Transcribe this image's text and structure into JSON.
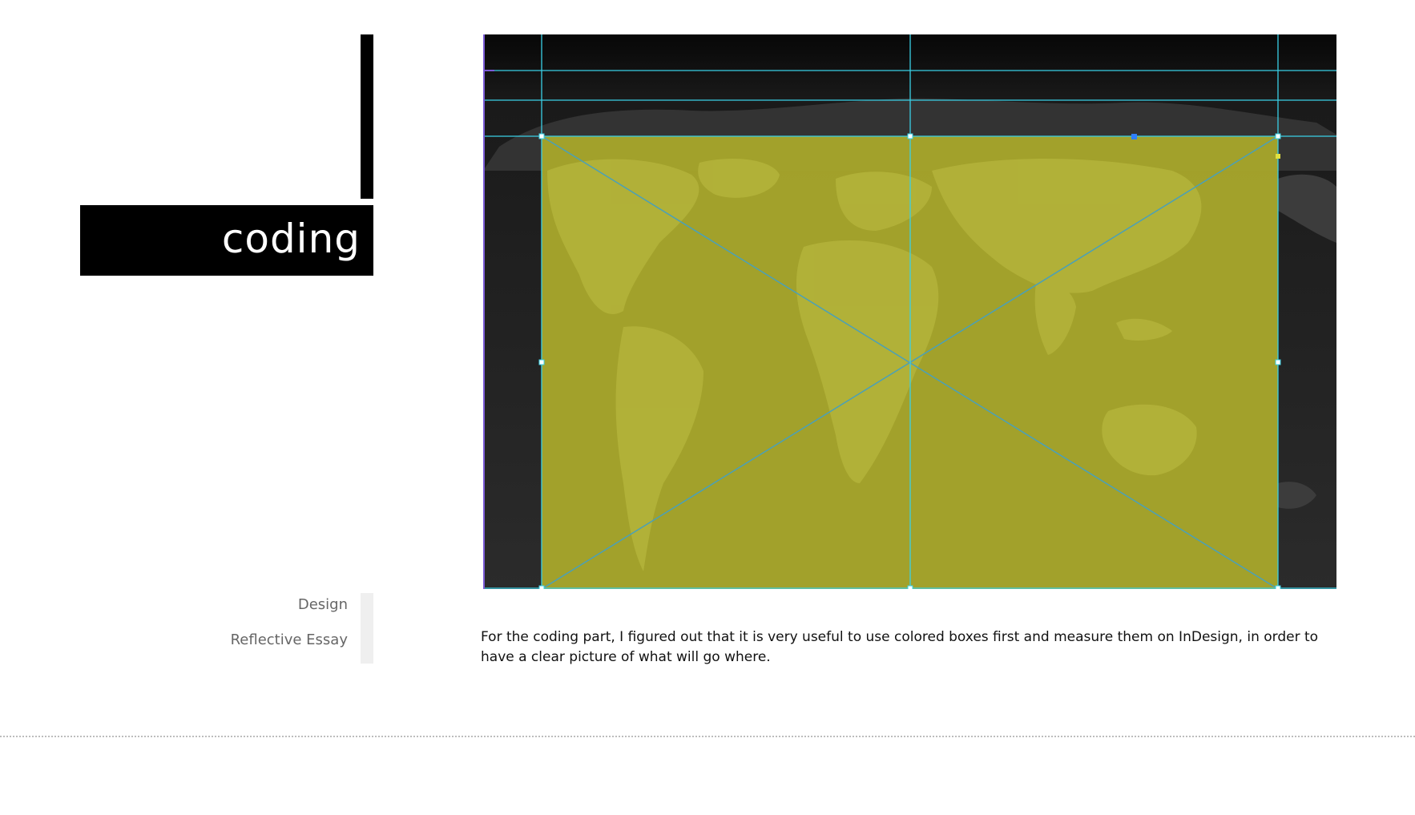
{
  "title": "coding",
  "nav": {
    "items": [
      {
        "label": "Design"
      },
      {
        "label": "Reflective Essay"
      }
    ]
  },
  "caption": "For the coding part, I figured out that it is very useful to use colored boxes first and measure them on InDesign, in order to have a clear picture of what will go where.",
  "colors": {
    "accent_box": "#a6a52b",
    "guide_line": "#3ad0e6",
    "background_map": "#2a2a2a",
    "title_block": "#000000"
  }
}
